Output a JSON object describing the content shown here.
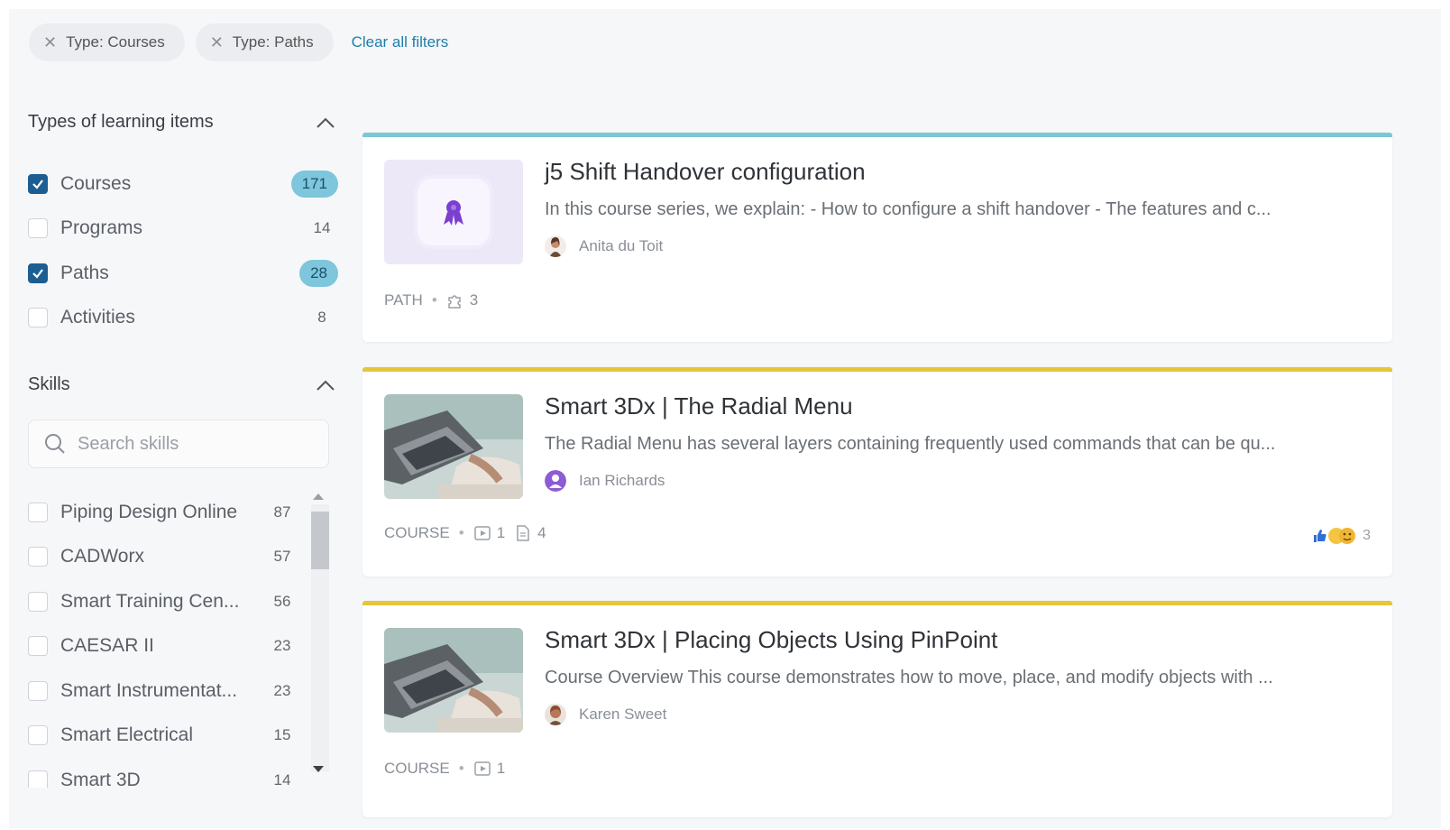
{
  "filters": {
    "chips": [
      {
        "label": "Type: Courses"
      },
      {
        "label": "Type: Paths"
      }
    ],
    "clear_all": "Clear all filters"
  },
  "types_section": {
    "title": "Types of learning items",
    "items": [
      {
        "label": "Courses",
        "count": "171",
        "checked": true
      },
      {
        "label": "Programs",
        "count": "14",
        "checked": false
      },
      {
        "label": "Paths",
        "count": "28",
        "checked": true
      },
      {
        "label": "Activities",
        "count": "8",
        "checked": false
      }
    ]
  },
  "skills_section": {
    "title": "Skills",
    "search_placeholder": "Search skills",
    "items": [
      {
        "label": "Piping Design Online",
        "count": "87"
      },
      {
        "label": "CADWorx",
        "count": "57"
      },
      {
        "label": "Smart Training Cen...",
        "count": "56"
      },
      {
        "label": "CAESAR II",
        "count": "23"
      },
      {
        "label": "Smart Instrumentat...",
        "count": "23"
      },
      {
        "label": "Smart Electrical",
        "count": "15"
      },
      {
        "label": "Smart 3D",
        "count": "14"
      }
    ]
  },
  "cards": [
    {
      "title": "j5 Shift Handover configuration",
      "description": "In this course series, we explain: - How to configure a shift handover - The features and c...",
      "author": "Anita du Toit",
      "type": "PATH",
      "meta": [
        "3"
      ],
      "accent": "#7cc7d6"
    },
    {
      "title": "Smart 3Dx | The Radial Menu",
      "description": "The Radial Menu has several layers containing frequently used commands that can be qu...",
      "author": "Ian Richards",
      "type": "COURSE",
      "meta": [
        "1",
        "4"
      ],
      "reactions": "3",
      "accent": "#e5c53a"
    },
    {
      "title": "Smart 3Dx | Placing Objects Using PinPoint",
      "description": "Course Overview This course demonstrates how to move, place, and modify objects with ...",
      "author": "Karen Sweet",
      "type": "COURSE",
      "meta": [
        "1"
      ],
      "accent": "#e5c53a"
    }
  ]
}
